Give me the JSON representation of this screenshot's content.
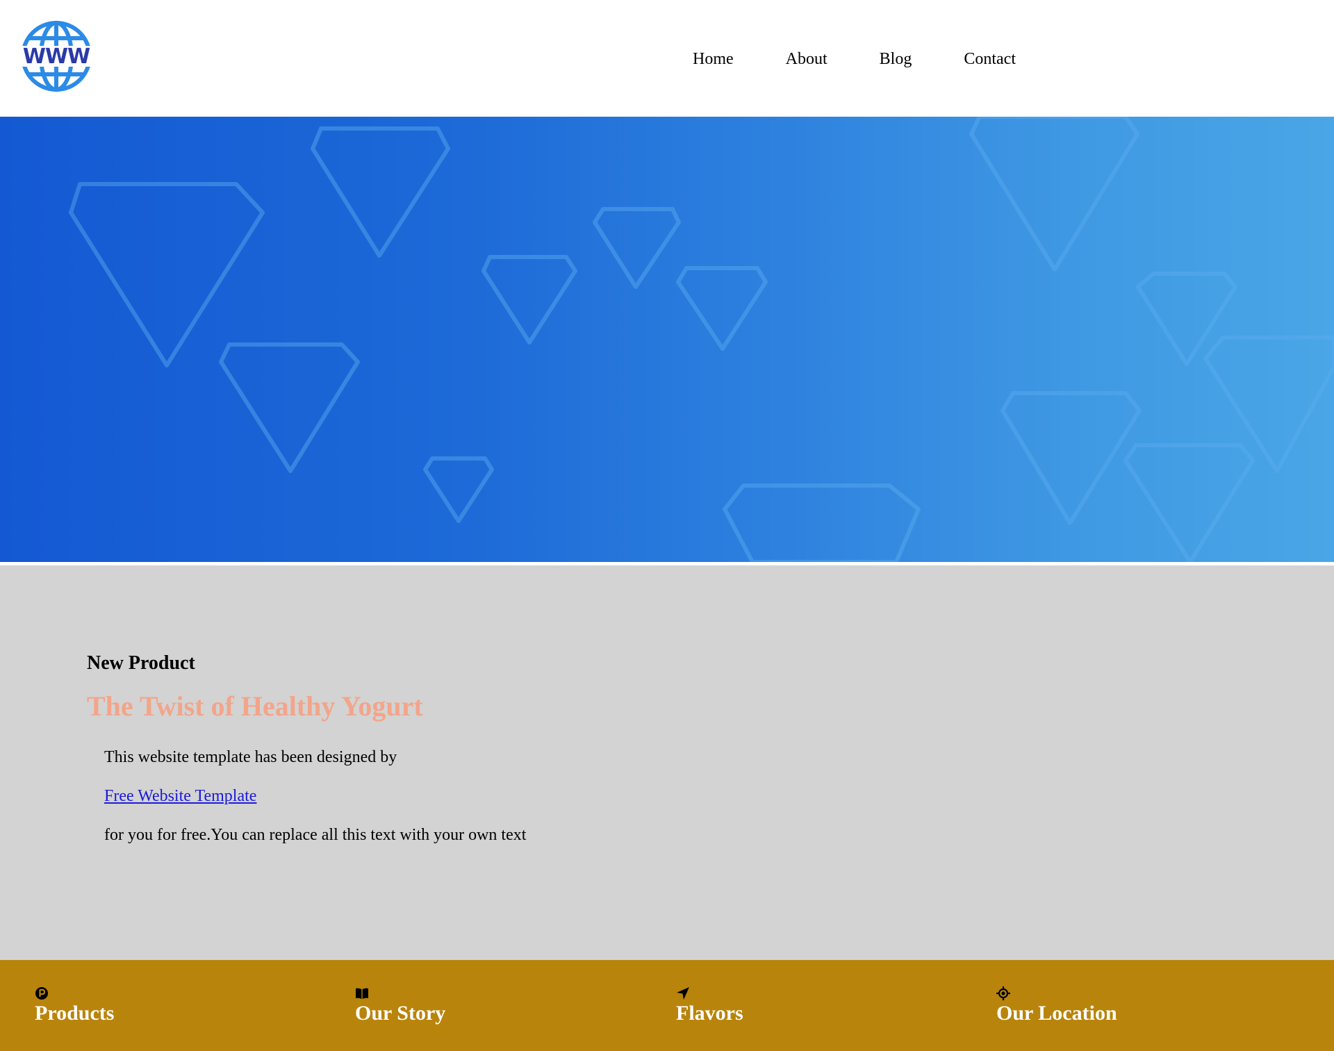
{
  "header": {
    "logo_text": "WWW",
    "nav": [
      {
        "label": "Home"
      },
      {
        "label": "About"
      },
      {
        "label": "Blog"
      },
      {
        "label": "Contact"
      }
    ]
  },
  "hero": {
    "gradient_start": "#1459d3",
    "gradient_end": "#4aa6e6"
  },
  "content": {
    "eyebrow": "New Product",
    "headline": "The Twist of Healthy Yogurt",
    "headline_color": "#f2a58a",
    "text_line_1": "This website template has been designed by",
    "link_text": "Free Website Template",
    "text_line_2": "for you for free.You can replace all this text with your own text"
  },
  "features": {
    "background": "#b8840b",
    "items": [
      {
        "label": "Products",
        "icon": "product-p-icon"
      },
      {
        "label": "Our Story",
        "icon": "book-icon"
      },
      {
        "label": "Flavors",
        "icon": "location-arrow-icon"
      },
      {
        "label": "Our Location",
        "icon": "crosshair-icon"
      }
    ]
  }
}
